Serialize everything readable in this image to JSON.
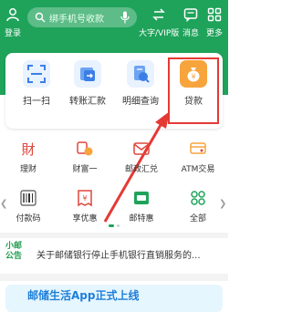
{
  "header": {
    "login_label": "登录",
    "search_placeholder": "绑手机号收款",
    "font_mode_label": "大字/VIP版",
    "message_label": "消息",
    "more_label": "更多"
  },
  "quick_actions": [
    {
      "label": "扫一扫",
      "icon": "scan-icon"
    },
    {
      "label": "转账汇款",
      "icon": "transfer-icon"
    },
    {
      "label": "明细查询",
      "icon": "statement-icon"
    },
    {
      "label": "贷款",
      "icon": "loan-bag-icon"
    }
  ],
  "services": [
    {
      "label": "理财",
      "icon": "wealth-icon"
    },
    {
      "label": "财富一",
      "icon": "coins-icon"
    },
    {
      "label": "邮政汇兑",
      "icon": "postal-remit-icon"
    },
    {
      "label": "ATM交易",
      "icon": "atm-card-icon"
    },
    {
      "label": "付款码",
      "icon": "barcode-icon"
    },
    {
      "label": "享优惠",
      "icon": "coupon-icon"
    },
    {
      "label": "邮特惠",
      "icon": "post-sale-icon"
    },
    {
      "label": "全部",
      "icon": "all-grid-icon"
    }
  ],
  "notice": {
    "logo_line1": "小邮",
    "logo_line2": "公告",
    "text": "关于邮储银行停止手机银行直销服务的..."
  },
  "banner": {
    "text": "邮储生活App正式上线"
  },
  "colors": {
    "brand_green": "#1fa35a",
    "loan_orange": "#f7a43c",
    "highlight_red": "#e53935"
  }
}
